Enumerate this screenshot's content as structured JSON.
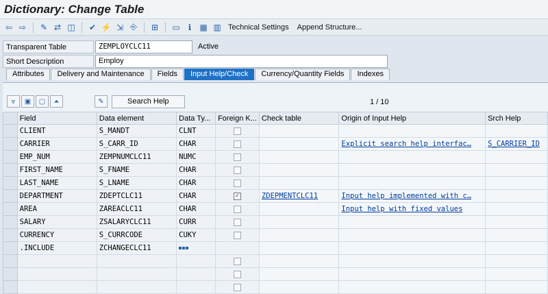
{
  "window": {
    "title": "Dictionary: Change Table"
  },
  "toolbar": {
    "icons": [
      "back-icon",
      "forward-icon",
      "display-change-icon",
      "active-inactive-icon",
      "other-object-icon",
      "check-icon",
      "activate-icon",
      "where-used-icon",
      "navigate-icon",
      "hierarchy-icon",
      "layout-icon",
      "info-icon",
      "contents-icon",
      "columns-icon"
    ],
    "technical_settings_label": "Technical Settings",
    "append_structure_label": "Append Structure..."
  },
  "header": {
    "transparent_table_label": "Transparent Table",
    "table_name": "ZEMPLOYCLC11",
    "status": "Active",
    "short_description_label": "Short Description",
    "short_description": "Employ"
  },
  "tabs": [
    {
      "label": "Attributes"
    },
    {
      "label": "Delivery and Maintenance"
    },
    {
      "label": "Fields"
    },
    {
      "label": "Input Help/Check",
      "active": true
    },
    {
      "label": "Currency/Quantity Fields"
    },
    {
      "label": "Indexes"
    }
  ],
  "table_toolbar": {
    "search_help_label": "Search Help",
    "pager": "1  /  10"
  },
  "grid": {
    "columns": [
      "Field",
      "Data element",
      "Data Ty...",
      "Foreign K...",
      "Check table",
      "Origin of Input Help",
      "Srch Help"
    ],
    "rows": [
      {
        "field": "CLIENT",
        "data_element": "S_MANDT",
        "data_type": "CLNT",
        "foreign_key": false,
        "check_table": "",
        "origin": "",
        "search_help": ""
      },
      {
        "field": "CARRIER",
        "data_element": "S_CARR_ID",
        "data_type": "CHAR",
        "foreign_key": false,
        "check_table": "",
        "origin": "Explicit search help interfac…",
        "search_help": "S_CARRIER_ID"
      },
      {
        "field": "EMP_NUM",
        "data_element": "ZEMPNUMCLC11",
        "data_type": "NUMC",
        "foreign_key": false,
        "check_table": "",
        "origin": "",
        "search_help": ""
      },
      {
        "field": "FIRST_NAME",
        "data_element": "S_FNAME",
        "data_type": "CHAR",
        "foreign_key": false,
        "check_table": "",
        "origin": "",
        "search_help": ""
      },
      {
        "field": "LAST_NAME",
        "data_element": "S_LNAME",
        "data_type": "CHAR",
        "foreign_key": false,
        "check_table": "",
        "origin": "",
        "search_help": ""
      },
      {
        "field": "DEPARTMENT",
        "data_element": "ZDEPTCLC11",
        "data_type": "CHAR",
        "foreign_key": true,
        "check_table": "ZDEPMENTCLC11",
        "origin": "Input help implemented with c…",
        "search_help": ""
      },
      {
        "field": "AREA",
        "data_element": "ZAREACLC11",
        "data_type": "CHAR",
        "foreign_key": false,
        "check_table": "",
        "origin": "Input help with fixed values",
        "search_help": ""
      },
      {
        "field": "SALARY",
        "data_element": "ZSALARYCLC11",
        "data_type": "CURR",
        "foreign_key": false,
        "check_table": "",
        "origin": "",
        "search_help": ""
      },
      {
        "field": "CURRENCY",
        "data_element": "S_CURRCODE",
        "data_type": "CUKY",
        "foreign_key": false,
        "check_table": "",
        "origin": "",
        "search_help": ""
      },
      {
        "field": ".INCLUDE",
        "data_element": "ZCHANGECLC11",
        "data_type": "",
        "foreign_key": null,
        "check_table": "",
        "origin": "",
        "search_help": "",
        "include_icon": "include-structure-icon"
      },
      {
        "field": "",
        "data_element": "",
        "data_type": "",
        "foreign_key": false,
        "check_table": "",
        "origin": "",
        "search_help": ""
      },
      {
        "field": "",
        "data_element": "",
        "data_type": "",
        "foreign_key": false,
        "check_table": "",
        "origin": "",
        "search_help": ""
      },
      {
        "field": "",
        "data_element": "",
        "data_type": "",
        "foreign_key": false,
        "check_table": "",
        "origin": "",
        "search_help": ""
      }
    ]
  }
}
